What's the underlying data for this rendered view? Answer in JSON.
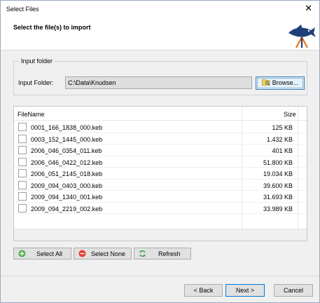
{
  "window": {
    "title": "Select Files",
    "close_glyph": "✕"
  },
  "header": {
    "text": "Select the file(s) to import",
    "logo_icon": "fish-logo-icon"
  },
  "input_group": {
    "legend": "Input folder",
    "folder_label": "Input Folder:",
    "folder_value": "C:\\Data\\Knudsen",
    "browse_label": "Browse..."
  },
  "file_list": {
    "columns": {
      "name": "FileName",
      "size": "Size"
    },
    "rows": [
      {
        "name": "0001_166_1838_000.keb",
        "size": "125 KB"
      },
      {
        "name": "0003_152_1445_000.keb",
        "size": "1.432 KB"
      },
      {
        "name": "2006_046_0354_011.keb",
        "size": "401 KB"
      },
      {
        "name": "2006_046_0422_012.keb",
        "size": "51.800 KB"
      },
      {
        "name": "2006_051_2145_018.keb",
        "size": "19.034 KB"
      },
      {
        "name": "2009_094_0403_000.keb",
        "size": "39.600 KB"
      },
      {
        "name": "2009_094_1340_001.keb",
        "size": "31.693 KB"
      },
      {
        "name": "2009_094_2219_002.keb",
        "size": "33.989 KB"
      }
    ]
  },
  "actions": {
    "select_all": "Select All",
    "select_none": "Select None",
    "refresh": "Refresh"
  },
  "nav": {
    "back": "< Back",
    "next": "Next >",
    "cancel": "Cancel"
  },
  "colors": {
    "accent_border": "#0078d7",
    "select_all_icon": "#4caf50",
    "select_none_icon": "#e53935",
    "refresh_icon": "#43a047",
    "logo_blue": "#1f3f7a",
    "logo_orange": "#e8721c"
  }
}
